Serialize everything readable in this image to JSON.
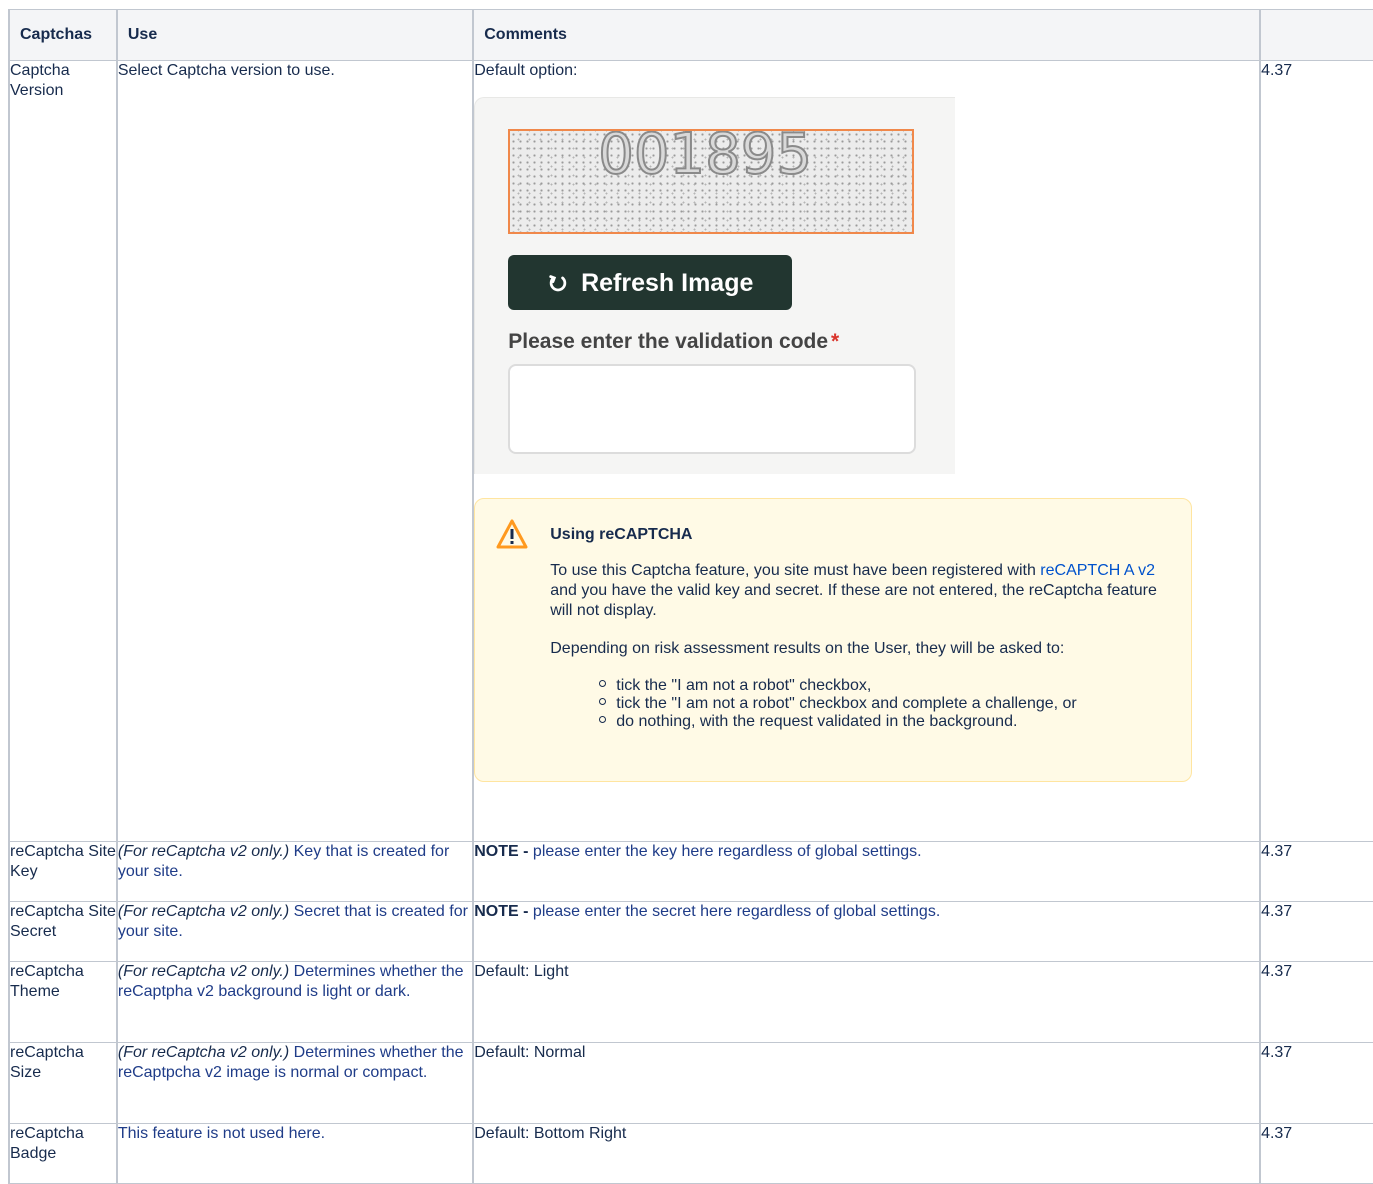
{
  "table": {
    "headers": [
      "Captchas",
      "Use",
      "Comments",
      ""
    ],
    "rows": [
      {
        "name": "Captcha Version",
        "use_plain": "Select Captcha version to use.",
        "comment_plain": "Default option:",
        "version": "4.37"
      },
      {
        "name": "reCaptcha Site Key",
        "use_prefix": "(For reCaptcha v2 only.)",
        "use_text": " Key that is created for your site.",
        "comment_bold": "NOTE -",
        "comment_text": " please enter the key here regardless of global settings.",
        "version": "4.37"
      },
      {
        "name": "reCaptcha Site Secret",
        "use_prefix": "(For reCaptcha v2 only.)",
        "use_text": " Secret that is created for your site.",
        "comment_bold": "NOTE -",
        "comment_text": " please enter the secret here regardless of global settings.",
        "version": "4.37"
      },
      {
        "name": "reCaptcha Theme",
        "use_prefix": "(For reCaptcha v2 only.)",
        "use_text": " Determines whether the reCaptpha v2 background is light or dark.",
        "comment_plain": "Default: Light",
        "version": "4.37"
      },
      {
        "name": "reCaptcha Size",
        "use_prefix": "(For reCaptcha v2 only.)",
        "use_text": " Determines whether the reCaptpcha v2 image is normal or compact.",
        "comment_plain": "Default: Normal",
        "version": "4.37"
      },
      {
        "name": "reCaptcha Badge",
        "use_text": "This feature is not used here.",
        "comment_plain": "Default: Bottom Right",
        "version": "4.37"
      }
    ]
  },
  "captcha_example": {
    "code": "001895",
    "refresh_label": "Refresh Image",
    "validation_label": "Please enter the validation code",
    "required_mark": "*"
  },
  "warning": {
    "title": "Using reCAPTCHA",
    "p1_before": "To use this Captcha feature, you site must have been registered with ",
    "p1_link": "reCAPTCH A v2",
    "p1_after": " and you have the valid key and secret. If these are not entered, the reCaptcha feature will not display.",
    "p2": "Depending on risk assessment results on the User, they will be asked to:",
    "items": [
      "tick the \"I am not a robot\" checkbox,",
      "tick the \"I am not a robot\" checkbox and complete a challenge, or",
      "do nothing, with the request validated in the background."
    ]
  },
  "colors": {
    "link": "#0052cc",
    "warning_bg": "#fffae6",
    "button_bg": "#223630",
    "captcha_border": "#f0884a"
  }
}
